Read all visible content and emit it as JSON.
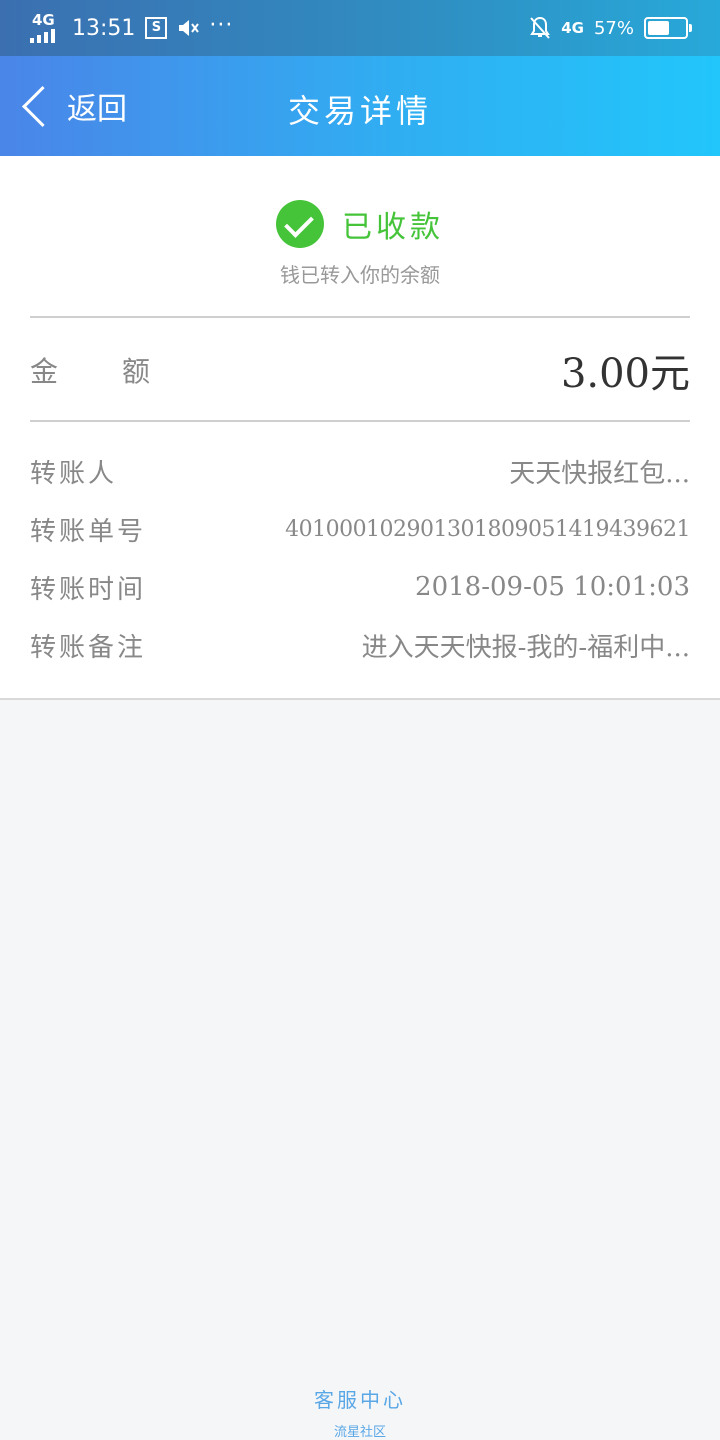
{
  "status_bar": {
    "network": "4G",
    "time": "13:51",
    "notif_icon": "S",
    "more": "···",
    "network_right": "4G",
    "battery_percent": "57%",
    "battery_level": 0.57
  },
  "nav": {
    "back_label": "返回",
    "title": "交易详情"
  },
  "status": {
    "text": "已收款",
    "sub_text": "钱已转入你的余额",
    "accent_color": "#45c439"
  },
  "amount": {
    "label": "金额",
    "value": "3.00元"
  },
  "details": [
    {
      "label": "转账人",
      "value": "天天快报红包..."
    },
    {
      "label": "转账单号",
      "value": "401000102901301809051419439621"
    },
    {
      "label": "转账时间",
      "value": "2018-09-05 10:01:03"
    },
    {
      "label": "转账备注",
      "value": "进入天天快报-我的-福利中..."
    }
  ],
  "footer": {
    "service_label": "客服中心",
    "watermark": "流星社区",
    "link_color": "#5aa7e6"
  }
}
